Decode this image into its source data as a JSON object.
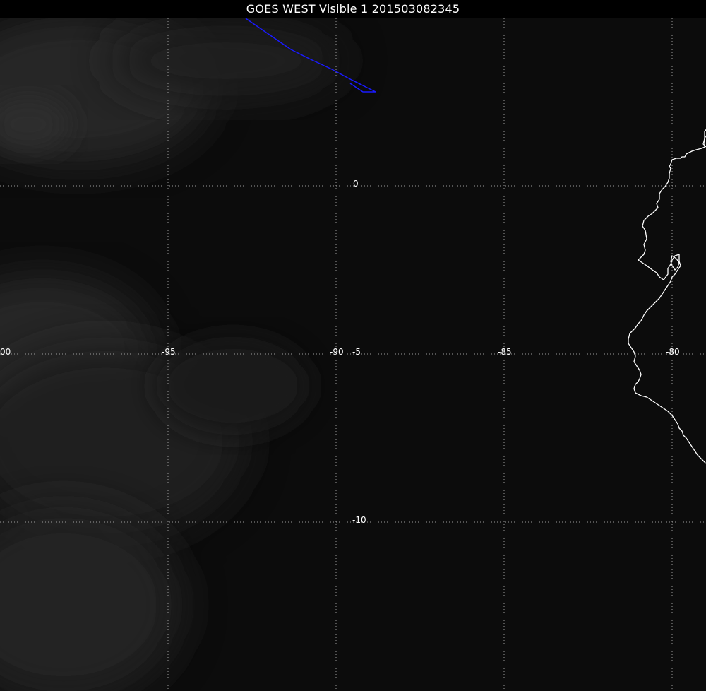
{
  "title": "GOES WEST Visible 1 201503082345",
  "grid": {
    "longitude_labels": [
      "-95",
      "-90",
      "-85",
      "-80"
    ],
    "latitude_labels": [
      "0",
      "-5",
      "-10"
    ],
    "edge_label": "00"
  },
  "colors": {
    "background": "#000000",
    "ocean": "#0b0b0b",
    "grid_line": "#9a9a9a",
    "coastline": "#ffffff",
    "track_line": "#1a1aff",
    "label_text": "#ffffff"
  }
}
